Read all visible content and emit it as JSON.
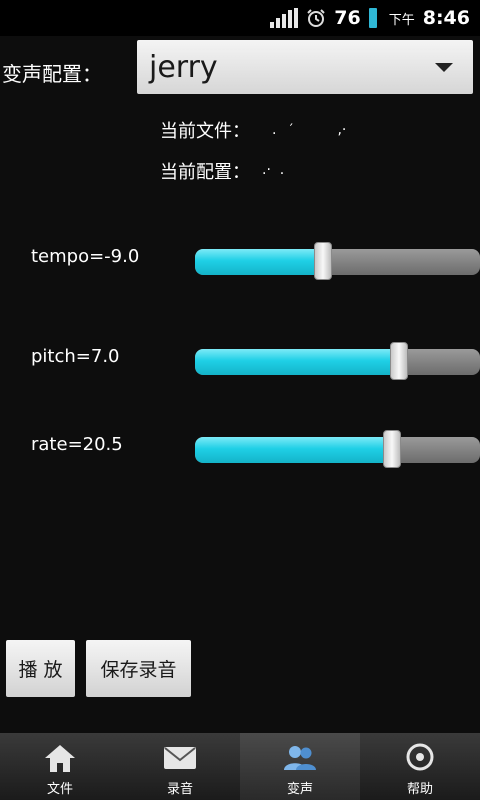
{
  "status": {
    "battery": "76",
    "ampm": "下午",
    "time": "8:46"
  },
  "config": {
    "label": "变声配置：",
    "selected": "jerry"
  },
  "info": {
    "current_file_label": "当前文件：",
    "current_config_label": "当前配置："
  },
  "sliders": [
    {
      "label": "tempo=-9.0",
      "fraction": 0.45
    },
    {
      "label": "pitch=7.0",
      "fraction": 0.715
    },
    {
      "label": "rate=20.5",
      "fraction": 0.69
    }
  ],
  "buttons": {
    "play": "播 放",
    "save": "保存录音"
  },
  "tabs": [
    {
      "label": "文件",
      "icon": "home-icon",
      "active": false
    },
    {
      "label": "录音",
      "icon": "envelope-icon",
      "active": false
    },
    {
      "label": "变声",
      "icon": "users-icon",
      "active": true
    },
    {
      "label": "帮助",
      "icon": "help-icon",
      "active": false
    }
  ]
}
